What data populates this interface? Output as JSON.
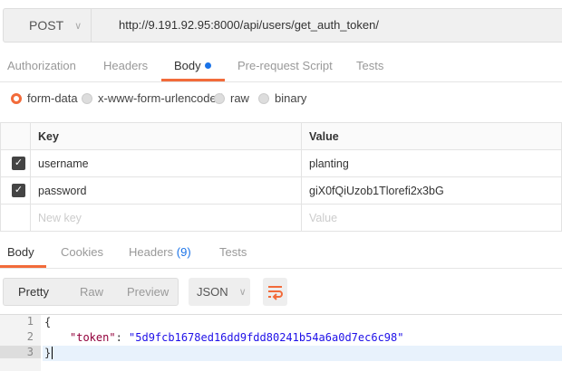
{
  "request": {
    "method": "POST",
    "url": "http://9.191.92.95:8000/api/users/get_auth_token/"
  },
  "request_tabs": [
    {
      "label": "Authorization"
    },
    {
      "label": "Headers"
    },
    {
      "label": "Body",
      "active": true
    },
    {
      "label": "Pre-request Script"
    },
    {
      "label": "Tests"
    }
  ],
  "body_modes": [
    {
      "label": "form-data",
      "selected": true
    },
    {
      "label": "x-www-form-urlencoded"
    },
    {
      "label": "raw"
    },
    {
      "label": "binary"
    }
  ],
  "table": {
    "headers": [
      "Key",
      "Value"
    ],
    "rows": [
      {
        "checked": true,
        "key": "username",
        "value": "planting"
      },
      {
        "checked": true,
        "key": "password",
        "value": "giX0fQiUzob1Tlorefi2x3bG"
      }
    ],
    "placeholder": {
      "key": "New key",
      "value": "Value"
    }
  },
  "response_tabs": [
    {
      "label": "Body",
      "active": true
    },
    {
      "label": "Cookies"
    },
    {
      "label": "Headers",
      "count": "(9)"
    },
    {
      "label": "Tests"
    }
  ],
  "view_modes": [
    "Pretty",
    "Raw",
    "Preview"
  ],
  "format": "JSON",
  "code": {
    "lines": [
      "1",
      "2",
      "3"
    ],
    "open": "{",
    "key": "\"token\"",
    "colon": ": ",
    "value": "\"5d9fcb1678ed16dd9fdd80241b54a6a0d7ec6c98\"",
    "close": "}"
  },
  "colors": {
    "accent": "#f26b3a",
    "link": "#1a73e8"
  }
}
